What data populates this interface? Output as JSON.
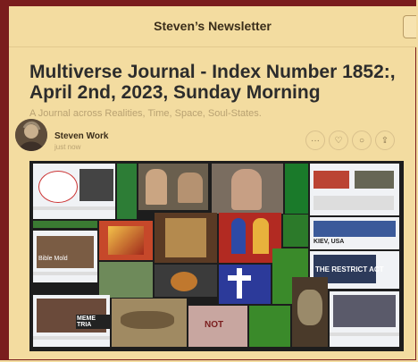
{
  "header": {
    "title": "Steven’s Newsletter"
  },
  "post": {
    "title": "Multiverse Journal - Index Number 1852:, April 2nd, 2023, Sunday Morning",
    "subtitle": "A Journal across Realities, Time, Space, Soul-States.",
    "author": "Steven Work",
    "time": "just now"
  },
  "actions": [
    {
      "name": "more-options-icon",
      "glyph": "···"
    },
    {
      "name": "heart-icon",
      "glyph": "♡"
    },
    {
      "name": "comment-icon",
      "glyph": "○"
    },
    {
      "name": "share-icon",
      "glyph": "⇪"
    }
  ],
  "collage_text": {
    "kiev": "KIEV, USA",
    "restrict": "THE RESTRICT ACT",
    "meme": "MEME TRIA",
    "mold": "Bible Mold",
    "not": "NOT"
  },
  "colors": {
    "accent": "#7a1d1d",
    "background": "#f3dca0"
  }
}
